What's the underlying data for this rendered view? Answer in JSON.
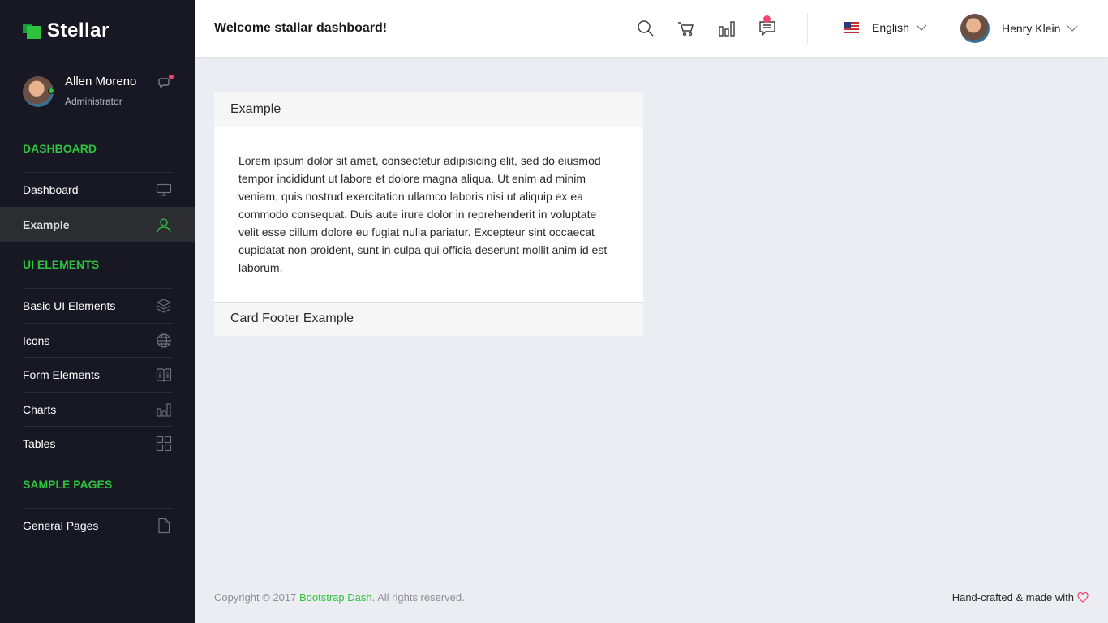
{
  "brand": {
    "name": "Stellar",
    "accent": "#2ec23e"
  },
  "profile": {
    "name": "Allen Moreno",
    "role": "Administrator"
  },
  "sidebar": {
    "categories": [
      "DASHBOARD",
      "UI ELEMENTS",
      "SAMPLE PAGES"
    ],
    "items": [
      {
        "label": "Dashboard",
        "icon": "monitor-icon"
      },
      {
        "label": "Example",
        "icon": "user-icon"
      },
      {
        "label": "Basic UI Elements",
        "icon": "layers-icon"
      },
      {
        "label": "Icons",
        "icon": "globe-icon"
      },
      {
        "label": "Form Elements",
        "icon": "book-icon"
      },
      {
        "label": "Charts",
        "icon": "bar-chart-icon"
      },
      {
        "label": "Tables",
        "icon": "grid-icon"
      },
      {
        "label": "General Pages",
        "icon": "file-icon"
      }
    ],
    "active_item": "Example"
  },
  "header": {
    "title": "Welcome stallar dashboard!",
    "icons": [
      "search-icon",
      "cart-icon",
      "bar-chart-icon",
      "message-icon"
    ],
    "language": "English",
    "user_name": "Henry Klein"
  },
  "card": {
    "header": "Example",
    "body": "Lorem ipsum dolor sit amet, consectetur adipisicing elit, sed do eiusmod tempor incididunt ut labore et dolore magna aliqua. Ut enim ad minim veniam, quis nostrud exercitation ullamco laboris nisi ut aliquip ex ea commodo consequat. Duis aute irure dolor in reprehenderit in voluptate velit esse cillum dolore eu fugiat nulla pariatur. Excepteur sint occaecat cupidatat non proident, sunt in culpa qui officia deserunt mollit anim id est laborum.",
    "footer": "Card Footer Example"
  },
  "footer": {
    "copyright_prefix": "Copyright © 2017 ",
    "copyright_link": "Bootstrap Dash",
    "copyright_suffix": ". All rights reserved.",
    "tagline": "Hand-crafted & made with"
  }
}
